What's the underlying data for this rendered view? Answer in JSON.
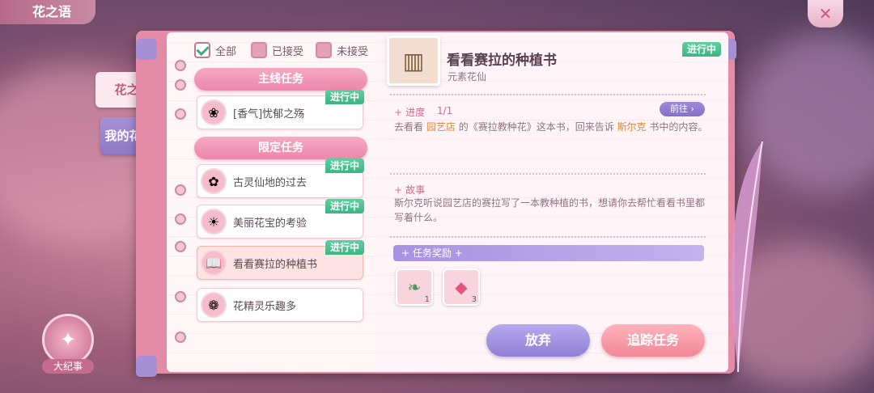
{
  "header": {
    "title": "花之语"
  },
  "close_icon": "flower-close-icon",
  "side_tabs": {
    "active": "花之语",
    "inactive": "我的花语录"
  },
  "filters": [
    {
      "label": "全部",
      "checked": true
    },
    {
      "label": "已接受",
      "checked": false
    },
    {
      "label": "未接受",
      "checked": false
    }
  ],
  "sections": {
    "main": "主线任务",
    "limited": "限定任务"
  },
  "quests": {
    "main": [
      {
        "name": "[香气]忧郁之殇",
        "status": "进行中"
      }
    ],
    "limited": [
      {
        "name": "古灵仙地的过去",
        "status": "进行中"
      },
      {
        "name": "美丽花宝的考验",
        "status": "进行中"
      },
      {
        "name": "看看赛拉的种植书",
        "status": "进行中",
        "selected": true
      },
      {
        "name": "花精灵乐趣多",
        "status": ""
      }
    ]
  },
  "detail": {
    "title": "看看赛拉的种植书",
    "subtitle": "元素花仙",
    "status": "进行中",
    "progress_label": "进度",
    "progress_value": "1/1",
    "goto_label": "前往",
    "progress_text": {
      "p1": "去看看",
      "place": "园艺店",
      "p2": "的《赛拉教种花》这本书，回来告诉",
      "person": "斯尔克",
      "p3": "书中的内容。"
    },
    "story_label": "故事",
    "story_text": "斯尔克听说园艺店的赛拉写了一本教种植的书，想请你去帮忙看看书里都写着什么。",
    "reward_label": "任务奖励",
    "rewards": [
      {
        "icon": "seed-icon",
        "count": "1"
      },
      {
        "icon": "gem-icon",
        "count": "3"
      }
    ],
    "abandon_label": "放弃",
    "track_label": "追踪任务"
  },
  "chronicle": {
    "label": "大纪事"
  },
  "colors": {
    "accent_pink": "#ec86aa",
    "accent_purple": "#8e7fd6",
    "status_green": "#3bb584",
    "highlight_orange": "#e8882a"
  }
}
